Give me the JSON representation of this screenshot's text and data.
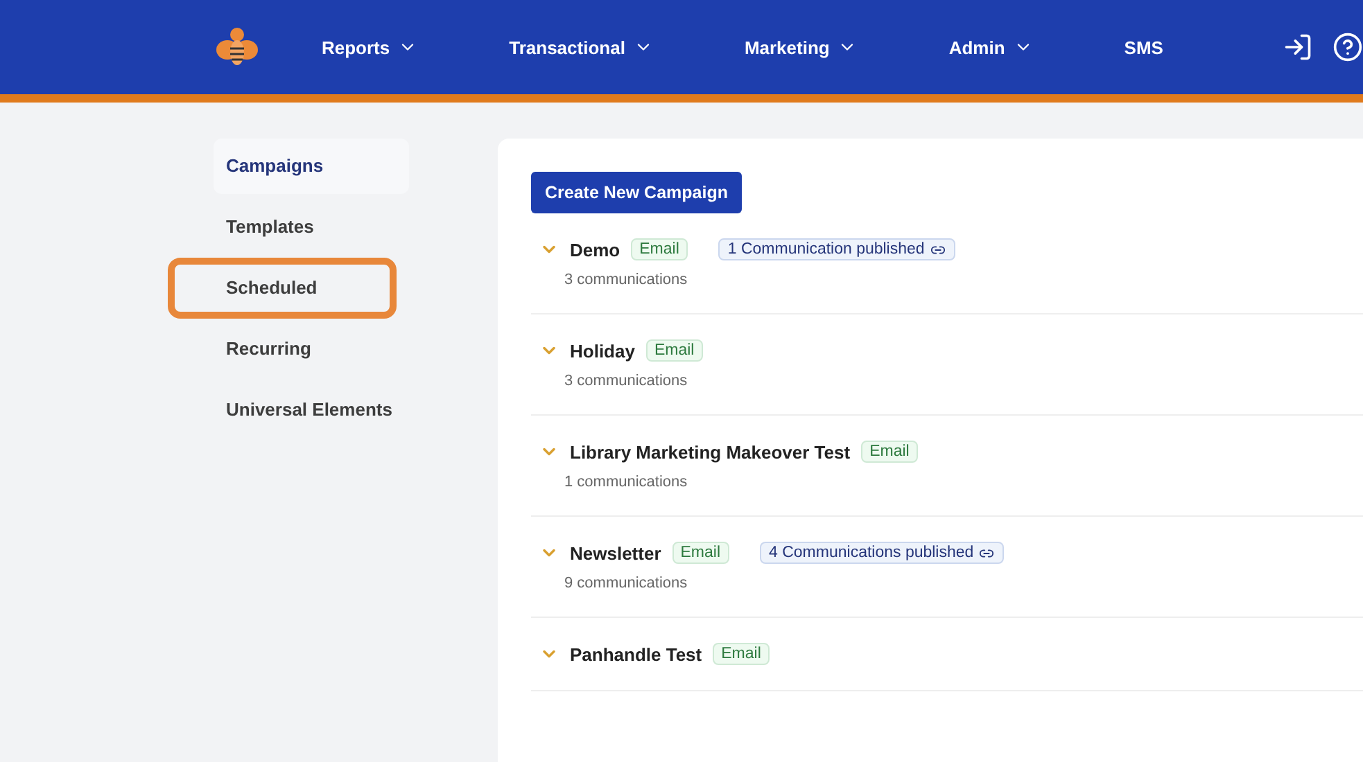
{
  "nav": {
    "items": [
      {
        "label": "Reports",
        "dropdown": true
      },
      {
        "label": "Transactional",
        "dropdown": true
      },
      {
        "label": "Marketing",
        "dropdown": true
      },
      {
        "label": "Admin",
        "dropdown": true
      },
      {
        "label": "SMS",
        "dropdown": false
      }
    ]
  },
  "sidebar": {
    "items": [
      {
        "label": "Campaigns",
        "selected": true,
        "highlighted": false
      },
      {
        "label": "Templates",
        "selected": false,
        "highlighted": false
      },
      {
        "label": "Scheduled",
        "selected": false,
        "highlighted": true
      },
      {
        "label": "Recurring",
        "selected": false,
        "highlighted": false
      },
      {
        "label": "Universal Elements",
        "selected": false,
        "highlighted": false
      }
    ]
  },
  "main": {
    "create_button": "Create New Campaign",
    "campaigns": [
      {
        "name": "Demo",
        "tag": "Email",
        "published": "1 Communication published",
        "count": "3 communications"
      },
      {
        "name": "Holiday",
        "tag": "Email",
        "count": "3 communications"
      },
      {
        "name": "Library Marketing Makeover Test",
        "tag": "Email",
        "count": "1 communications"
      },
      {
        "name": "Newsletter",
        "tag": "Email",
        "published": "4 Communications published",
        "count": "9 communications"
      },
      {
        "name": "Panhandle Test",
        "tag": "Email"
      }
    ]
  }
}
